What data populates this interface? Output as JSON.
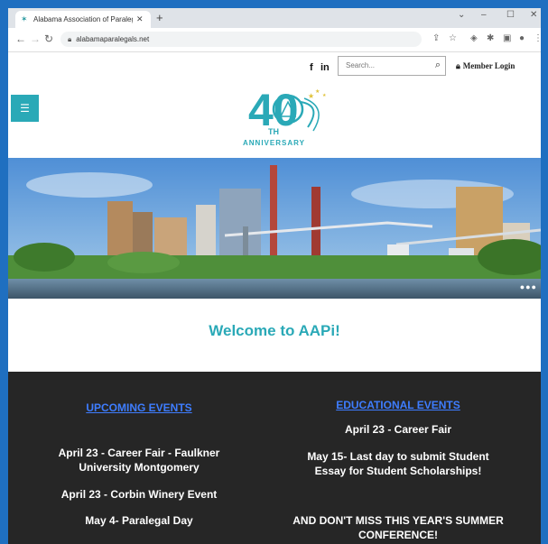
{
  "browser": {
    "tab_title": "Alabama Association of Paraleg...",
    "tab_close": "✕",
    "new_tab": "+",
    "url": "alabamaparalegals.net",
    "window_controls": [
      "⌄",
      "–",
      "☐",
      "✕"
    ]
  },
  "header": {
    "social": [
      "f",
      "in"
    ],
    "search_placeholder": "Search...",
    "member_login": "Member Login"
  },
  "logo": {
    "number": "40",
    "suffix": "TH",
    "tagline": "ANNIVERSARY"
  },
  "welcome": "Welcome to AAPi!",
  "upcoming": {
    "heading": "UPCOMING EVENTS",
    "items": [
      "April 23 - Career Fair - Faulkner",
      "University Montgomery",
      "April 23 - Corbin Winery Event",
      "May 4- Paralegal Day"
    ]
  },
  "educational": {
    "heading": "EDUCATIONAL EVENTS",
    "items": [
      "April 23 - Career Fair",
      "May 15- Last day to submit Student",
      "Essay for Student Scholarships!",
      "AND DON'T MISS THIS YEAR'S SUMMER",
      "CONFERENCE!"
    ]
  },
  "colors": {
    "accent": "#2aa9b7",
    "dark_band": "#262626",
    "link": "#3e7dff"
  }
}
